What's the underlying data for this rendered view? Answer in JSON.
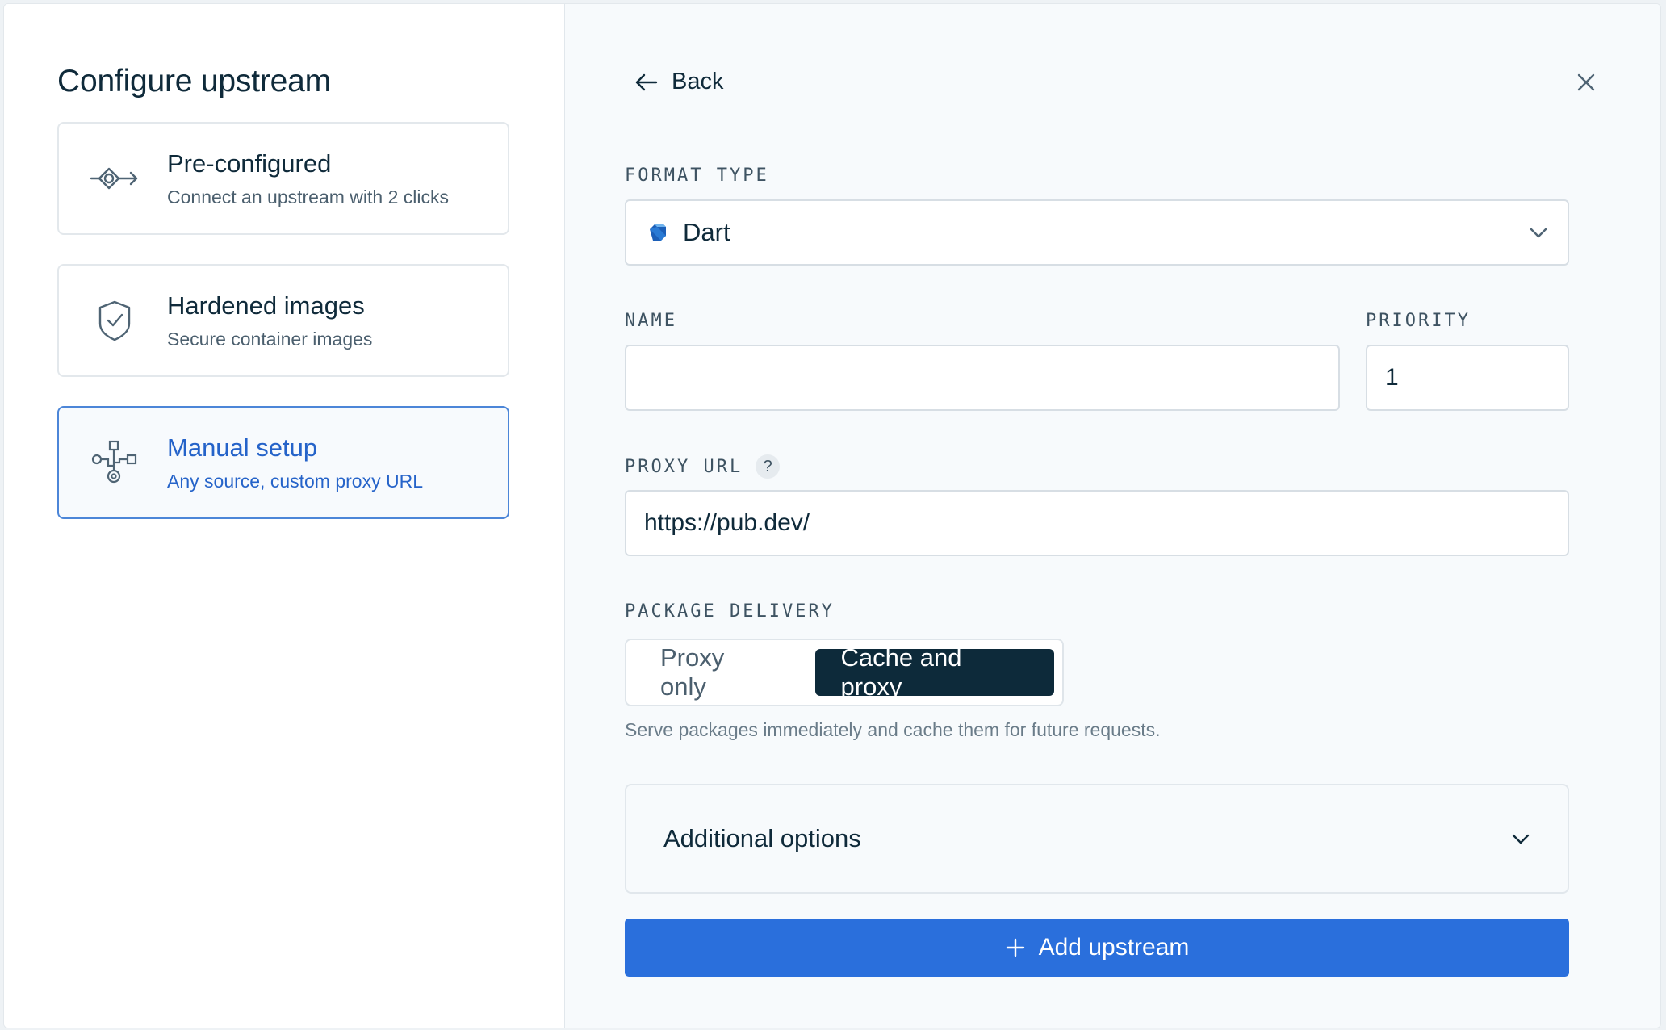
{
  "left_panel": {
    "title": "Configure upstream",
    "options": [
      {
        "icon": "pre-configured-icon",
        "title": "Pre-configured",
        "subtitle": "Connect an upstream with 2 clicks",
        "selected": false
      },
      {
        "icon": "shield-check-icon",
        "title": "Hardened images",
        "subtitle": "Secure container images",
        "selected": false
      },
      {
        "icon": "manual-setup-icon",
        "title": "Manual setup",
        "subtitle": "Any source, custom proxy URL",
        "selected": true
      }
    ]
  },
  "right_panel": {
    "back_label": "Back",
    "format_type": {
      "label": "FORMAT TYPE",
      "value": "Dart",
      "icon": "dart-logo-icon"
    },
    "name": {
      "label": "NAME",
      "value": "",
      "placeholder": ""
    },
    "priority": {
      "label": "PRIORITY",
      "value": "1"
    },
    "proxy_url": {
      "label": "PROXY URL",
      "help": "?",
      "value": "https://pub.dev/"
    },
    "package_delivery": {
      "label": "PACKAGE DELIVERY",
      "options": [
        "Proxy only",
        "Cache and proxy"
      ],
      "selected": "Cache and proxy",
      "hint": "Serve packages immediately and cache them for future requests."
    },
    "additional_options_label": "Additional options",
    "submit_label": "Add upstream"
  },
  "colors": {
    "accent": "#2a6fdc",
    "selected_text": "#2563c9",
    "segment_active": "#0d2a3a",
    "text_primary": "#0f2a3a"
  }
}
